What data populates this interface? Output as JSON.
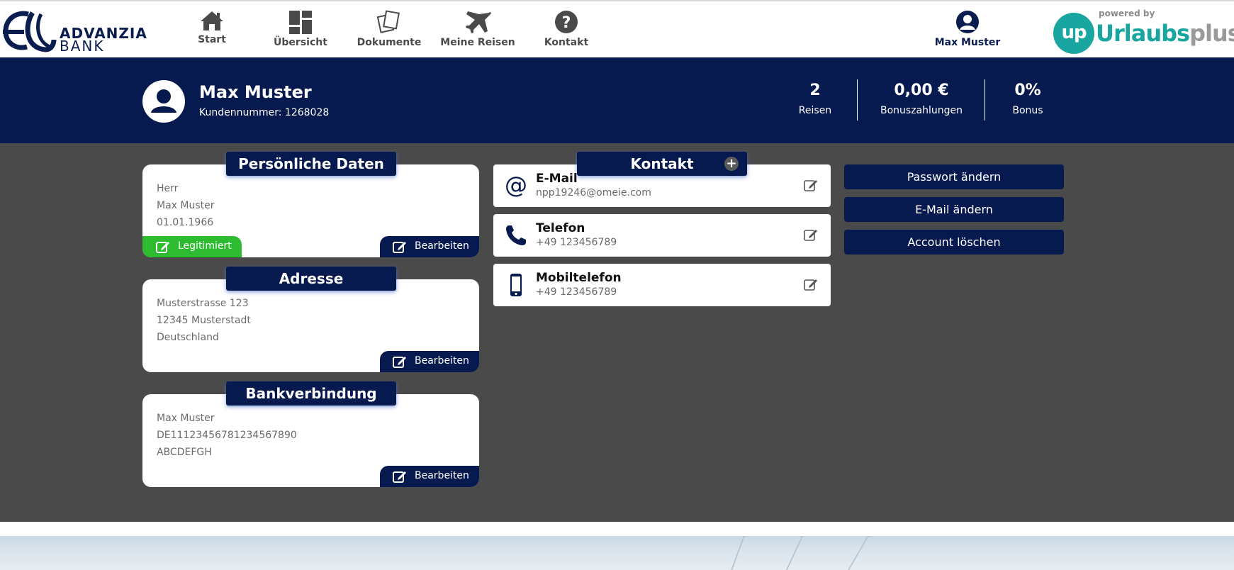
{
  "brand": {
    "line1": "ADVANZIA",
    "line2": "BANK"
  },
  "nav": [
    {
      "label": "Start",
      "icon": "home-icon"
    },
    {
      "label": "Übersicht",
      "icon": "dashboard-icon"
    },
    {
      "label": "Dokumente",
      "icon": "documents-icon"
    },
    {
      "label": "Meine Reisen",
      "icon": "airplane-icon"
    },
    {
      "label": "Kontakt",
      "icon": "help-icon"
    }
  ],
  "user": {
    "label": "Max Muster",
    "icon": "user-icon"
  },
  "partner": {
    "powered_by": "powered by",
    "circle": "up",
    "brand_a": "Urlaubs",
    "brand_b": "plus"
  },
  "profile": {
    "name": "Max Muster",
    "customer_number": "Kundennummer: 1268028",
    "stats": [
      {
        "value": "2",
        "label": "Reisen"
      },
      {
        "value": "0,00 €",
        "label": "Bonuszahlungen"
      },
      {
        "value": "0%",
        "label": "Bonus"
      }
    ]
  },
  "personal": {
    "title": "Persönliche Daten",
    "lines": [
      "Herr",
      "Max Muster",
      "01.01.1966"
    ],
    "status": "Legitimiert",
    "edit": "Bearbeiten"
  },
  "address": {
    "title": "Adresse",
    "lines": [
      "Musterstrasse 123",
      "12345 Musterstadt",
      "Deutschland"
    ],
    "edit": "Bearbeiten"
  },
  "bank": {
    "title": "Bankverbindung",
    "lines": [
      "Max Muster",
      "DE11123456781234567890",
      "ABCDEFGH"
    ],
    "edit": "Bearbeiten"
  },
  "contact": {
    "title": "Kontakt",
    "plus": "+",
    "rows": [
      {
        "title": "E-Mail",
        "value": "npp19246@omeie.com",
        "icon": "at-icon"
      },
      {
        "title": "Telefon",
        "value": "+49 123456789",
        "icon": "phone-icon"
      },
      {
        "title": "Mobiltelefon",
        "value": "+49 123456789",
        "icon": "mobile-phone-icon"
      }
    ]
  },
  "account": {
    "change_password": "Passwort ändern",
    "change_email": "E-Mail ändern",
    "delete_account": "Account löschen"
  },
  "colors": {
    "navy": "#061a4f",
    "green": "#2dbb2f",
    "grey_bg": "#4a4a4a",
    "teal": "#1aa6a0"
  }
}
